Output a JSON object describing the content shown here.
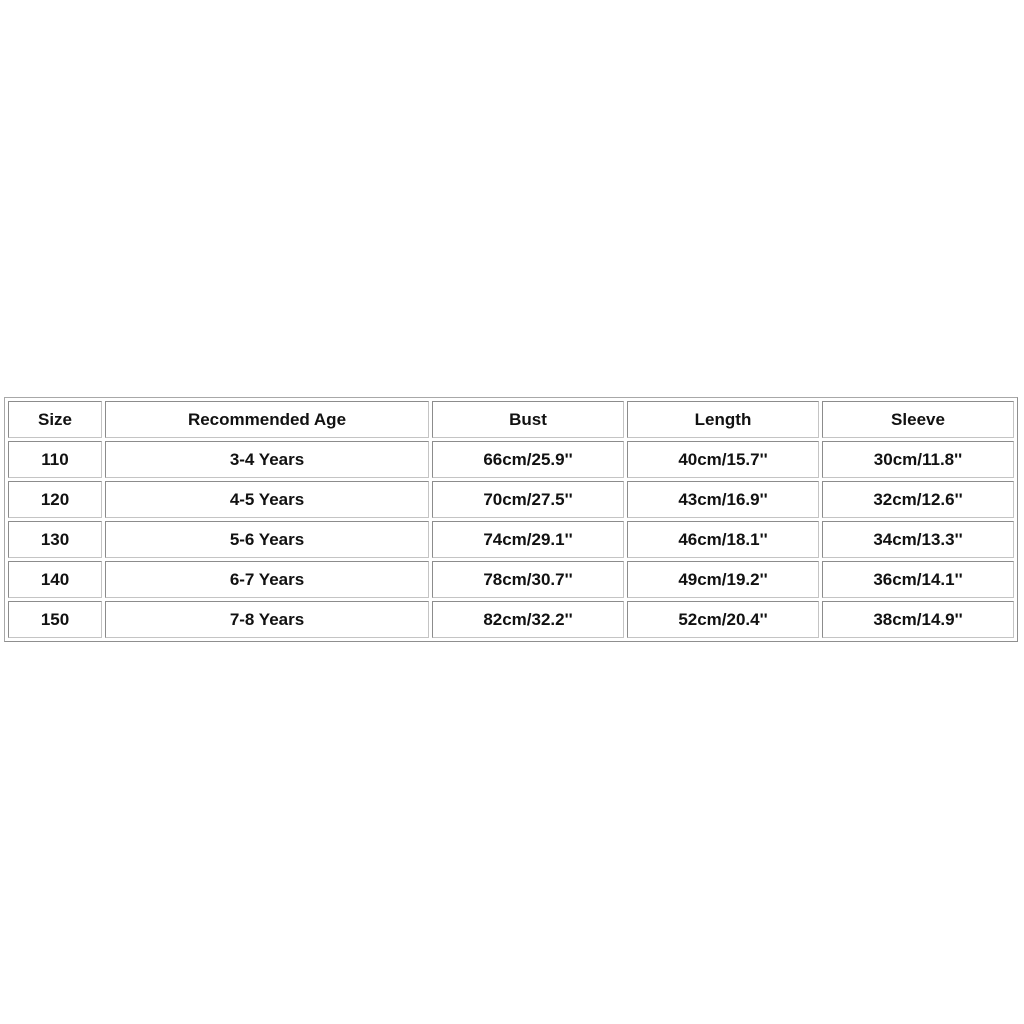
{
  "size_chart": {
    "headers": [
      "Size",
      "Recommended Age",
      "Bust",
      "Length",
      "Sleeve"
    ],
    "rows": [
      [
        "110",
        "3-4 Years",
        "66cm/25.9''",
        "40cm/15.7''",
        "30cm/11.8''"
      ],
      [
        "120",
        "4-5 Years",
        "70cm/27.5''",
        "43cm/16.9''",
        "32cm/12.6''"
      ],
      [
        "130",
        "5-6 Years",
        "74cm/29.1''",
        "46cm/18.1''",
        "34cm/13.3''"
      ],
      [
        "140",
        "6-7 Years",
        "78cm/30.7''",
        "49cm/19.2''",
        "36cm/14.1''"
      ],
      [
        "150",
        "7-8 Years",
        "82cm/32.2''",
        "52cm/20.4''",
        "38cm/14.9''"
      ]
    ]
  }
}
